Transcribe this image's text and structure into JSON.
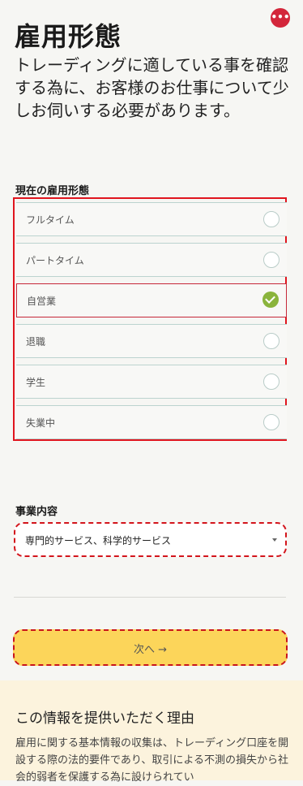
{
  "header": {
    "more_label": "•••",
    "title": "雇用形態",
    "subtitle": "トレーディングに適している事を確認する為に、お客様のお仕事について少しお伺いする必要があります。"
  },
  "employment": {
    "label": "現在の雇用形態",
    "options": [
      {
        "label": "フルタイム",
        "selected": false
      },
      {
        "label": "パートタイム",
        "selected": false
      },
      {
        "label": "自営業",
        "selected": true
      },
      {
        "label": "退職",
        "selected": false
      },
      {
        "label": "学生",
        "selected": false
      },
      {
        "label": "失業中",
        "selected": false
      }
    ]
  },
  "business": {
    "label": "事業内容",
    "selected_value": "専門的サービス、科学的サービス"
  },
  "next_button": {
    "label": "次へ →"
  },
  "reason": {
    "title": "この情報を提供いただく理由",
    "body": "雇用に関する基本情報の収集は、トレーディング口座を開設する際の法的要件であり、取引による不測の損失から社会的弱者を保護する為に設けられてい"
  },
  "colors": {
    "accent_red": "#d3263a",
    "check_green": "#8ab43c",
    "button_yellow": "#fcd55a",
    "reason_bg": "#fcf3dd"
  }
}
